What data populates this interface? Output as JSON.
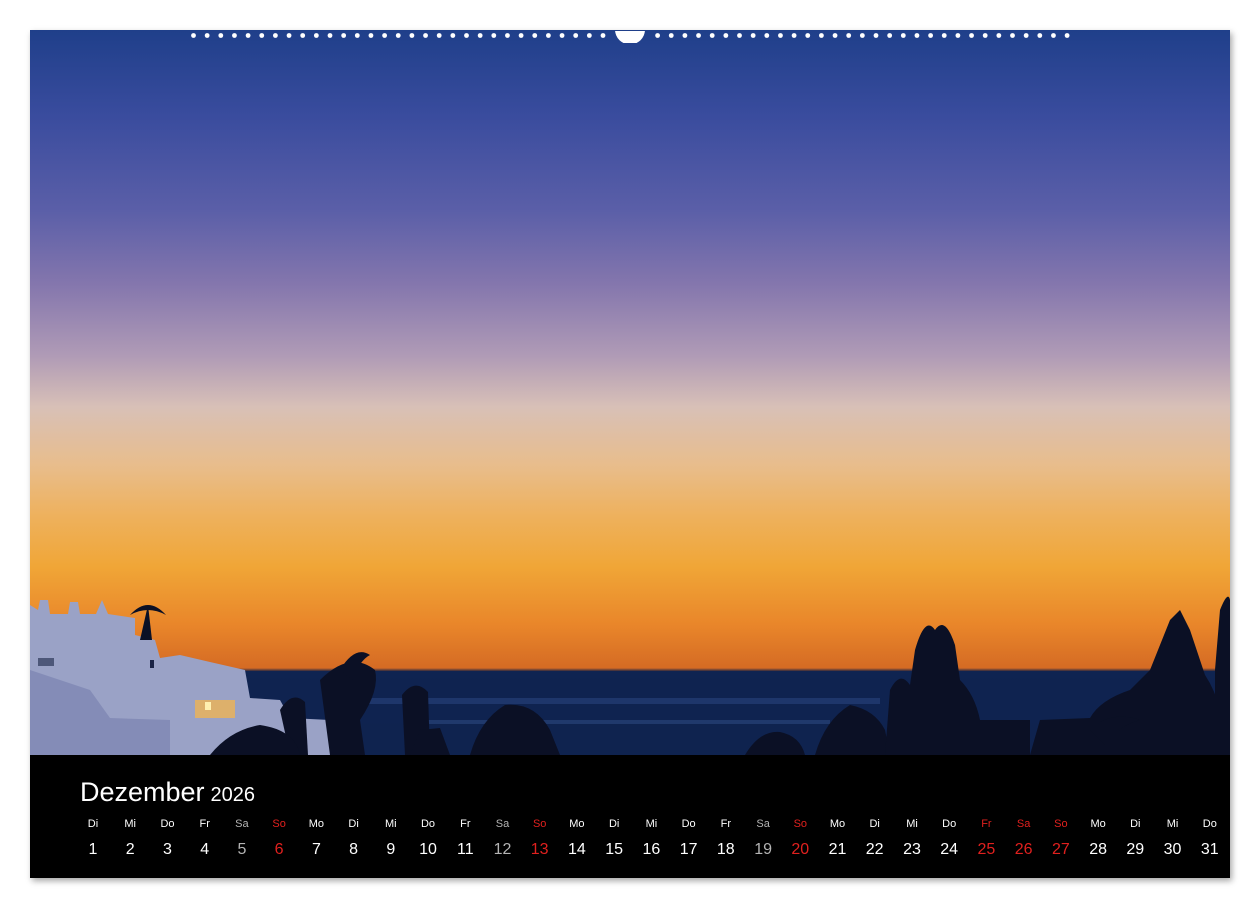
{
  "calendar": {
    "month": "Dezember",
    "year": "2026",
    "days": [
      {
        "wd": "Di",
        "d": "1",
        "type": "normal"
      },
      {
        "wd": "Mi",
        "d": "2",
        "type": "normal"
      },
      {
        "wd": "Do",
        "d": "3",
        "type": "normal"
      },
      {
        "wd": "Fr",
        "d": "4",
        "type": "normal"
      },
      {
        "wd": "Sa",
        "d": "5",
        "type": "saturday"
      },
      {
        "wd": "So",
        "d": "6",
        "type": "holiday"
      },
      {
        "wd": "Mo",
        "d": "7",
        "type": "normal"
      },
      {
        "wd": "Di",
        "d": "8",
        "type": "normal"
      },
      {
        "wd": "Mi",
        "d": "9",
        "type": "normal"
      },
      {
        "wd": "Do",
        "d": "10",
        "type": "normal"
      },
      {
        "wd": "Fr",
        "d": "11",
        "type": "normal"
      },
      {
        "wd": "Sa",
        "d": "12",
        "type": "saturday"
      },
      {
        "wd": "So",
        "d": "13",
        "type": "holiday"
      },
      {
        "wd": "Mo",
        "d": "14",
        "type": "normal"
      },
      {
        "wd": "Di",
        "d": "15",
        "type": "normal"
      },
      {
        "wd": "Mi",
        "d": "16",
        "type": "normal"
      },
      {
        "wd": "Do",
        "d": "17",
        "type": "normal"
      },
      {
        "wd": "Fr",
        "d": "18",
        "type": "normal"
      },
      {
        "wd": "Sa",
        "d": "19",
        "type": "saturday"
      },
      {
        "wd": "So",
        "d": "20",
        "type": "holiday"
      },
      {
        "wd": "Mo",
        "d": "21",
        "type": "normal"
      },
      {
        "wd": "Di",
        "d": "22",
        "type": "normal"
      },
      {
        "wd": "Mi",
        "d": "23",
        "type": "normal"
      },
      {
        "wd": "Do",
        "d": "24",
        "type": "normal"
      },
      {
        "wd": "Fr",
        "d": "25",
        "type": "holiday"
      },
      {
        "wd": "Sa",
        "d": "26",
        "type": "holiday"
      },
      {
        "wd": "So",
        "d": "27",
        "type": "holiday"
      },
      {
        "wd": "Mo",
        "d": "28",
        "type": "normal"
      },
      {
        "wd": "Di",
        "d": "29",
        "type": "normal"
      },
      {
        "wd": "Mi",
        "d": "30",
        "type": "normal"
      },
      {
        "wd": "Do",
        "d": "31",
        "type": "normal"
      }
    ]
  },
  "colors": {
    "normal": "#ffffff",
    "saturday": "#b4b4b4",
    "holiday": "#e0201e",
    "calendar_background": "#000000"
  },
  "photo": {
    "subject": "sunset-over-sea-with-white-village-silhouette"
  }
}
